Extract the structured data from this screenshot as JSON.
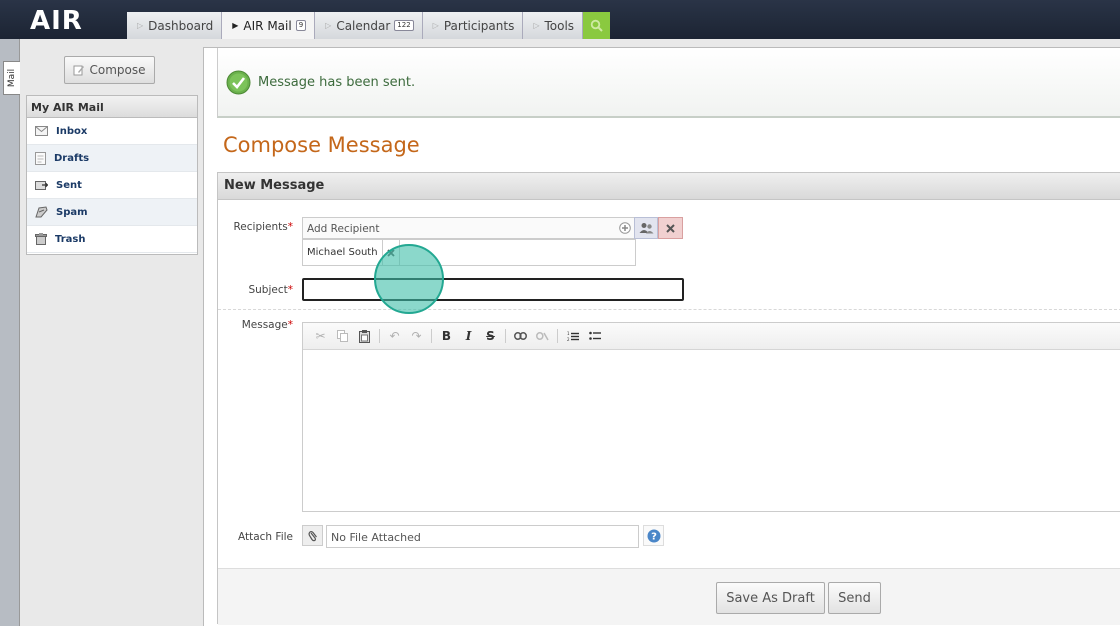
{
  "app": {
    "logo": "AIR"
  },
  "nav": {
    "tabs": [
      {
        "label": "Dashboard"
      },
      {
        "label": "AIR Mail",
        "badge": "9"
      },
      {
        "label": "Calendar",
        "badge": "122"
      },
      {
        "label": "Participants"
      },
      {
        "label": "Tools"
      }
    ]
  },
  "rail": {
    "tab": "Mail"
  },
  "sidebar": {
    "compose": "Compose",
    "panel_title": "My AIR Mail",
    "folders": [
      "Inbox",
      "Drafts",
      "Sent",
      "Spam",
      "Trash"
    ]
  },
  "notice": {
    "text": "Message has been sent."
  },
  "page": {
    "title": "Compose Message"
  },
  "form": {
    "header": "New Message",
    "recipients_label": "Recipients",
    "recipients_placeholder": "Add Recipient",
    "recipient_chip": "Michael South",
    "subject_label": "Subject",
    "subject_value": "",
    "message_label": "Message",
    "attach_label": "Attach File",
    "attach_value": "No File Attached",
    "required_mark": "*",
    "save_draft": "Save As Draft",
    "send": "Send"
  },
  "colors": {
    "accent": "#c4671a",
    "success": "#6ab04c",
    "search_tab": "#8ac93f"
  }
}
